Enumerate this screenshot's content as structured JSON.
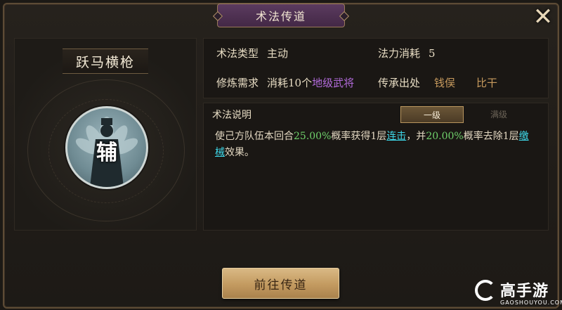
{
  "window": {
    "title": "术法传道"
  },
  "skill": {
    "name": "跃马横枪",
    "role_badge": "辅"
  },
  "info": {
    "type_label": "术法类型",
    "type_value": "主动",
    "cost_label": "法力消耗",
    "cost_value": "5",
    "req_label": "修炼需求",
    "req_prefix": "消耗10个",
    "req_item": "地级武将",
    "source_label": "传承出处",
    "sources": [
      "钱俣",
      "比干"
    ]
  },
  "description": {
    "title": "术法说明",
    "tabs": [
      "一级",
      "满级"
    ],
    "active_tab": "一级",
    "text_parts": {
      "p1": "使己方队伍本回合",
      "pct1": "25.00%",
      "p2": "概率获得1层",
      "link1": "连击",
      "p3": "，并",
      "pct2": "20.00%",
      "p4": "概率去除1层",
      "link2": "缴械",
      "p5": "效果。"
    }
  },
  "actions": {
    "go_button": "前往传道"
  },
  "watermark": {
    "brand": "高手游",
    "url": "GAOSHOUYOU.COM"
  },
  "colors": {
    "title_tab": "#4f3152",
    "accent_gold": "#c39a60",
    "highlight_green": "#6fd06b",
    "link_cyan": "#3ed7e8",
    "rarity_purple": "#b36bdc"
  }
}
